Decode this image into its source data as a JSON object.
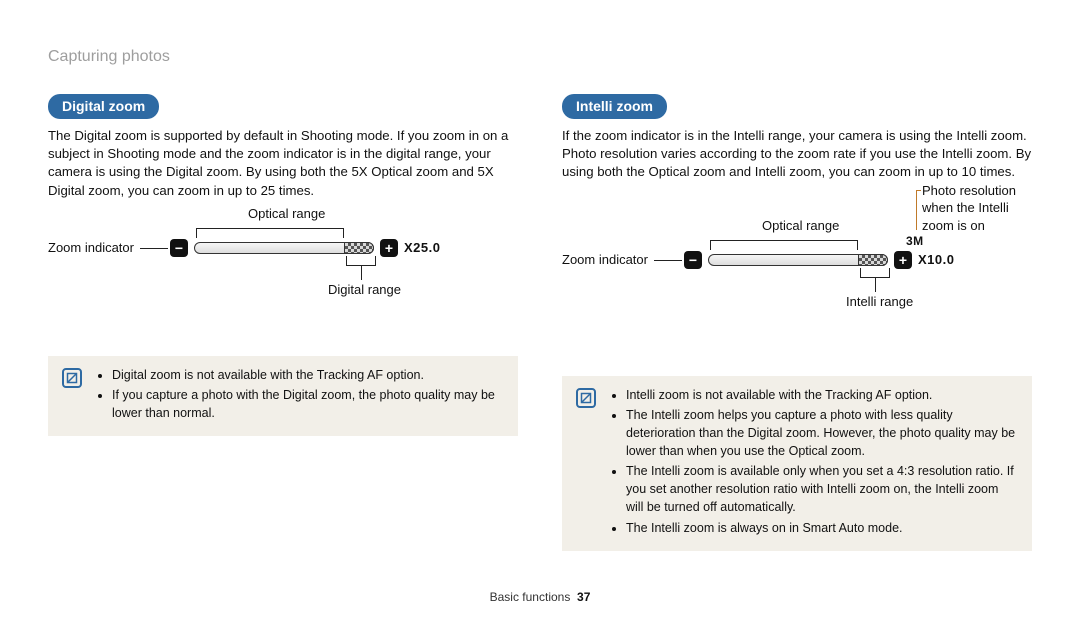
{
  "runningHead": "Capturing photos",
  "footer": {
    "section": "Basic functions",
    "page": "37"
  },
  "left": {
    "title": "Digital zoom",
    "body": "The Digital zoom is supported by default in Shooting mode. If you zoom in on a subject in Shooting mode and the zoom indicator is in the digital range, your camera is using the Digital zoom. By using both the 5X Optical zoom and 5X Digital zoom, you can zoom in up to 25 times.",
    "labels": {
      "opticalRange": "Optical range",
      "zoomIndicator": "Zoom indicator",
      "digitalRange": "Digital range",
      "readout": "X25.0"
    },
    "notes": [
      "Digital zoom is not available with the Tracking AF option.",
      "If you capture a photo with the Digital zoom, the photo quality may be lower than normal."
    ]
  },
  "right": {
    "title": "Intelli zoom",
    "body": "If the zoom indicator is in the Intelli range, your camera is using the Intelli zoom. Photo resolution varies according to the zoom rate if you use the Intelli zoom. By using both the Optical zoom and Intelli zoom, you can zoom in up to 10 times.",
    "labels": {
      "opticalRange": "Optical range",
      "zoomIndicator": "Zoom indicator",
      "intelliRange": "Intelli range",
      "photoRes": "Photo resolution when the Intelli zoom is on",
      "resBadge": "3M",
      "readout": "X10.0"
    },
    "notes": [
      "Intelli zoom is not available with the Tracking AF option.",
      "The Intelli zoom helps you capture a photo with less quality deterioration than the Digital zoom. However, the photo quality may be lower than when you use the Optical zoom.",
      "The Intelli zoom is available only when you set a 4:3 resolution ratio. If you set another resolution ratio with Intelli zoom on, the Intelli zoom will be turned off automatically.",
      "The Intelli zoom is always on in Smart Auto mode."
    ]
  }
}
